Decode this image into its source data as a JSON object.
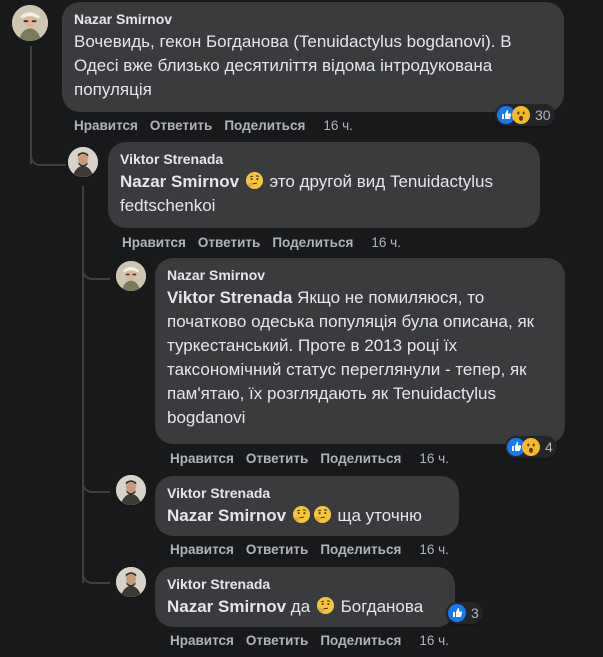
{
  "comments": [
    {
      "author": "Nazar Smirnov",
      "mention": "",
      "text": "Вочевидь, гекон Богданова (Tenuidactylus bogdanovi). В Одесі вже близько десятиліття відома інтродукована популяція",
      "actions": {
        "like": "Нравится",
        "reply": "Ответить",
        "share": "Поделиться",
        "time": "16 ч."
      },
      "reactions": {
        "icons": [
          "like-icon",
          "wow-icon"
        ],
        "count": "30"
      }
    },
    {
      "author": "Viktor Strenada",
      "mention": "Nazar Smirnov",
      "text": "это другой вид Tenuidactylus fedtschenkoi",
      "actions": {
        "like": "Нравится",
        "reply": "Ответить",
        "share": "Поделиться",
        "time": "16 ч."
      }
    },
    {
      "author": "Nazar Smirnov",
      "mention": "Viktor Strenada",
      "text": "Якщо не помиляюся, то початково одеська популяція була описана, як туркестанський. Проте в 2013 році їх таксономічний статус переглянули - тепер, як пам'ятаю, їх розглядають як Tenuidactylus bogdanovi",
      "actions": {
        "like": "Нравится",
        "reply": "Ответить",
        "share": "Поделиться",
        "time": "16 ч."
      },
      "reactions": {
        "icons": [
          "like-icon",
          "wow-icon"
        ],
        "count": "4"
      }
    },
    {
      "author": "Viktor Strenada",
      "mention": "Nazar Smirnov",
      "text": "ща уточню",
      "actions": {
        "like": "Нравится",
        "reply": "Ответить",
        "share": "Поделиться",
        "time": "16 ч."
      }
    },
    {
      "author": "Viktor Strenada",
      "mention": "Nazar Smirnov",
      "text": "Богданова",
      "prefix": "да",
      "actions": {
        "like": "Нравится",
        "reply": "Ответить",
        "share": "Поделиться",
        "time": "16 ч."
      },
      "reactions": {
        "icons": [
          "like-icon"
        ],
        "count": "3"
      }
    }
  ],
  "colors": {
    "background": "#18191a",
    "bubble": "#3a3b3c",
    "text": "#e4e6eb",
    "muted": "#b0b3b8",
    "like": "#1877f2",
    "wow": "#f7b928"
  }
}
